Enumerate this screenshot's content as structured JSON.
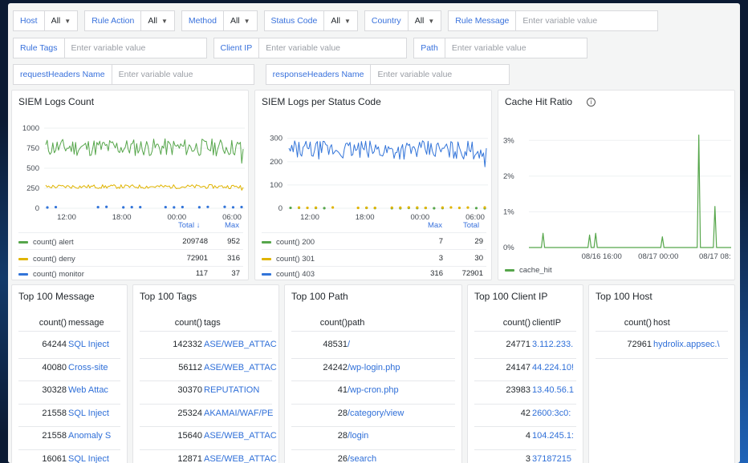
{
  "variables": {
    "host_label": "Host",
    "host_value": "All",
    "rule_action_label": "Rule Action",
    "rule_action_value": "All",
    "method_label": "Method",
    "method_value": "All",
    "status_code_label": "Status Code",
    "status_code_value": "All",
    "country_label": "Country",
    "country_value": "All",
    "rule_message_label": "Rule Message",
    "rule_tags_label": "Rule Tags",
    "client_ip_label": "Client IP",
    "path_label": "Path",
    "request_headers_label": "requestHeaders Name",
    "response_headers_label": "responseHeaders Name",
    "placeholder": "Enter variable value"
  },
  "panels": {
    "siem_count": {
      "title": "SIEM Logs Count",
      "col_total": "Total",
      "col_total_arrow": "↓",
      "col_max": "Max",
      "rows": [
        {
          "name": "count() alert",
          "color": "#56a64b",
          "total": "209748",
          "max": "952"
        },
        {
          "name": "count() deny",
          "color": "#e0b400",
          "total": "72901",
          "max": "316"
        },
        {
          "name": "count() monitor",
          "color": "#3274d9",
          "total": "117",
          "max": "37"
        }
      ]
    },
    "siem_status": {
      "title": "SIEM Logs per Status Code",
      "col_max": "Max",
      "col_total": "Total",
      "rows": [
        {
          "name": "count() 200",
          "color": "#56a64b",
          "max": "7",
          "total": "29"
        },
        {
          "name": "count() 301",
          "color": "#e0b400",
          "max": "3",
          "total": "30"
        },
        {
          "name": "count() 403",
          "color": "#3274d9",
          "max": "316",
          "total": "72901"
        }
      ]
    },
    "cache": {
      "title": "Cache Hit Ratio",
      "info_icon": "info-circle-icon",
      "legend": "cache_hit",
      "legend_color": "#56a64b"
    }
  },
  "chart_data": [
    {
      "type": "line",
      "title": "SIEM Logs Count",
      "x_ticks": [
        "12:00",
        "18:00",
        "00:00",
        "06:00"
      ],
      "y_ticks": [
        "0",
        "250",
        "500",
        "750",
        "1000"
      ],
      "ylim": [
        0,
        1000
      ],
      "series": [
        {
          "name": "count() alert",
          "color": "#56a64b",
          "level": 760,
          "amplitude": 110
        },
        {
          "name": "count() deny",
          "color": "#e0b400",
          "level": 270,
          "amplitude": 25
        },
        {
          "name": "count() monitor",
          "color": "#3274d9",
          "level": 4,
          "amplitude": 4
        }
      ]
    },
    {
      "type": "line",
      "title": "SIEM Logs per Status Code",
      "x_ticks": [
        "12:00",
        "18:00",
        "00:00",
        "06:00"
      ],
      "y_ticks": [
        "0",
        "100",
        "200",
        "300"
      ],
      "ylim": [
        0,
        330
      ],
      "series": [
        {
          "name": "count() 200",
          "color": "#56a64b",
          "level": 1,
          "amplitude": 1
        },
        {
          "name": "count() 301",
          "color": "#e0b400",
          "level": 1,
          "amplitude": 1
        },
        {
          "name": "count() 403",
          "color": "#3274d9",
          "level": 250,
          "amplitude": 40
        }
      ]
    },
    {
      "type": "line",
      "title": "Cache Hit Ratio",
      "x_ticks": [
        "08/16 16:00",
        "08/17 00:00",
        "08/17 08:"
      ],
      "y_ticks": [
        "0%",
        "1%",
        "2%",
        "3%"
      ],
      "ylim": [
        0,
        3.5
      ],
      "series": [
        {
          "name": "cache_hit",
          "color": "#56a64b",
          "spikes": [
            [
              0.07,
              0.4
            ],
            [
              0.3,
              0.35
            ],
            [
              0.33,
              0.4
            ],
            [
              0.66,
              0.3
            ],
            [
              0.84,
              3.15
            ],
            [
              0.92,
              1.15
            ]
          ]
        }
      ]
    }
  ],
  "tables": {
    "message": {
      "title": "Top 100 Message",
      "headers": [
        "count()",
        "message"
      ],
      "rows": [
        [
          "64244",
          "SQL Inject"
        ],
        [
          "40080",
          "Cross-site"
        ],
        [
          "30328",
          "Web Attac"
        ],
        [
          "21558",
          "SQL Inject"
        ],
        [
          "21558",
          "Anomaly S"
        ],
        [
          "16061",
          "SQL Inject"
        ]
      ]
    },
    "tags": {
      "title": "Top 100 Tags",
      "headers": [
        "count()",
        "tags"
      ],
      "rows": [
        [
          "142332",
          "ASE/WEB_ATTAC"
        ],
        [
          "56112",
          "ASE/WEB_ATTAC"
        ],
        [
          "30370",
          "REPUTATION"
        ],
        [
          "25324",
          "AKAMAI/WAF/PE"
        ],
        [
          "15640",
          "ASE/WEB_ATTAC"
        ],
        [
          "12871",
          "ASE/WEB_ATTAC"
        ]
      ]
    },
    "path": {
      "title": "Top 100 Path",
      "headers": [
        "count()",
        "path"
      ],
      "rows": [
        [
          "48531",
          "/"
        ],
        [
          "24242",
          "/wp-login.php"
        ],
        [
          "41",
          "/wp-cron.php"
        ],
        [
          "28",
          "/category/view"
        ],
        [
          "28",
          "/login"
        ],
        [
          "26",
          "/search"
        ]
      ]
    },
    "client_ip": {
      "title": "Top 100 Client IP",
      "headers": [
        "count()",
        "clientIP"
      ],
      "rows": [
        [
          "24771",
          "3.112.233."
        ],
        [
          "24147",
          "44.224.10!"
        ],
        [
          "23983",
          "13.40.56.1"
        ],
        [
          "42",
          "2600:3c0:"
        ],
        [
          "4",
          "104.245.1:"
        ],
        [
          "3",
          "37187215"
        ]
      ]
    },
    "host": {
      "title": "Top 100 Host",
      "headers": [
        "count()",
        "host"
      ],
      "rows": [
        [
          "72961",
          "hydrolix.appsec.\\"
        ]
      ]
    }
  }
}
